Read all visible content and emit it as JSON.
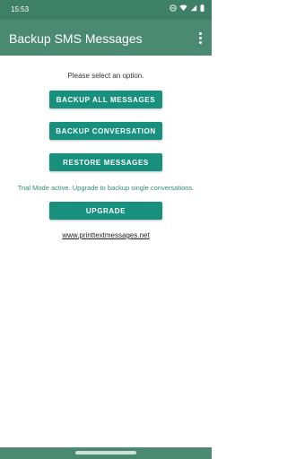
{
  "status": {
    "time": "15:53"
  },
  "appbar": {
    "title": "Backup SMS Messages"
  },
  "main": {
    "prompt": "Please select an option.",
    "backup_all_label": "BACKUP ALL MESSAGES",
    "backup_conversation_label": "BACKUP CONVERSATION",
    "restore_label": "RESTORE MESSAGES",
    "trial_text": "Trial Mode active. Upgrade to backup single conversations.",
    "upgrade_label": "UPGRADE",
    "link_text": "www.printtextmessages.net"
  },
  "colors": {
    "appbar": "#4b8a72",
    "statusbar": "#3d7f67",
    "button": "#17907d",
    "trial_text": "#2f8a76"
  }
}
